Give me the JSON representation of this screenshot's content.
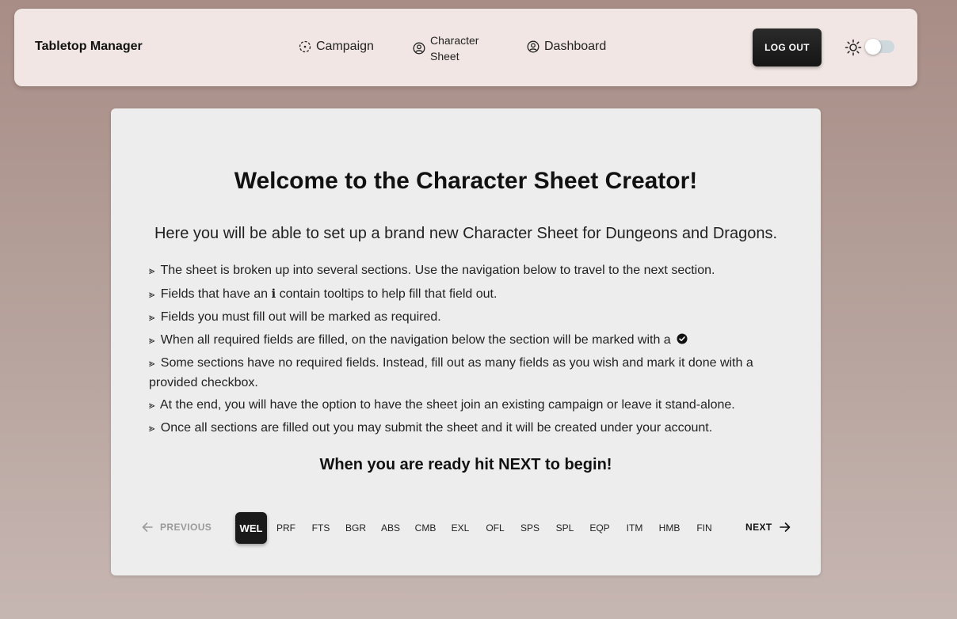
{
  "header": {
    "brand": "Tabletop Manager",
    "nav": [
      {
        "label": "Campaign",
        "icon": "campaign-icon"
      },
      {
        "label": "Character Sheet",
        "icon": "user-circle-icon"
      },
      {
        "label": "Dashboard",
        "icon": "user-circle-icon"
      }
    ],
    "logout_label": "LOG OUT",
    "theme_toggle_on": false
  },
  "main": {
    "title": "Welcome to the Character Sheet Creator!",
    "subtitle": "Here you will be able to set up a brand new Character Sheet for Dungeons and Dragons.",
    "bullet_mark": "⪢",
    "bullets": [
      {
        "text": "The sheet is broken up into several sections. Use the navigation below to travel to the next section."
      },
      {
        "before": "Fields that have an",
        "info_glyph": "i",
        "after": "contain tooltips to help fill that field out."
      },
      {
        "text": "Fields you must fill out will be marked as required."
      },
      {
        "text": "When all required fields are filled, on the navigation below the section will be marked with a"
      },
      {
        "text": "Some sections have no required fields. Instead, fill out as many fields as you wish and mark it done with a provided checkbox."
      },
      {
        "text": "At the end, you will have the option to have the sheet join an existing campaign or leave it stand-alone."
      },
      {
        "text": "Once all sections are filled out you may submit the sheet and it will be created under your account."
      }
    ],
    "ready": "When you are ready hit NEXT to begin!"
  },
  "stepper": {
    "previous_label": "PREVIOUS",
    "next_label": "NEXT",
    "active_step": "WEL",
    "steps": [
      "WEL",
      "PRF",
      "FTS",
      "BGR",
      "ABS",
      "CMB",
      "EXL",
      "OFL",
      "SPS",
      "SPL",
      "EQP",
      "ITM",
      "HMB",
      "FIN"
    ]
  },
  "colors": {
    "header_bg": "#f1e6e3",
    "card_bg": "#ededed",
    "active_step_bg": "#1a1a1a",
    "logout_bg": "#1f1f1f"
  }
}
